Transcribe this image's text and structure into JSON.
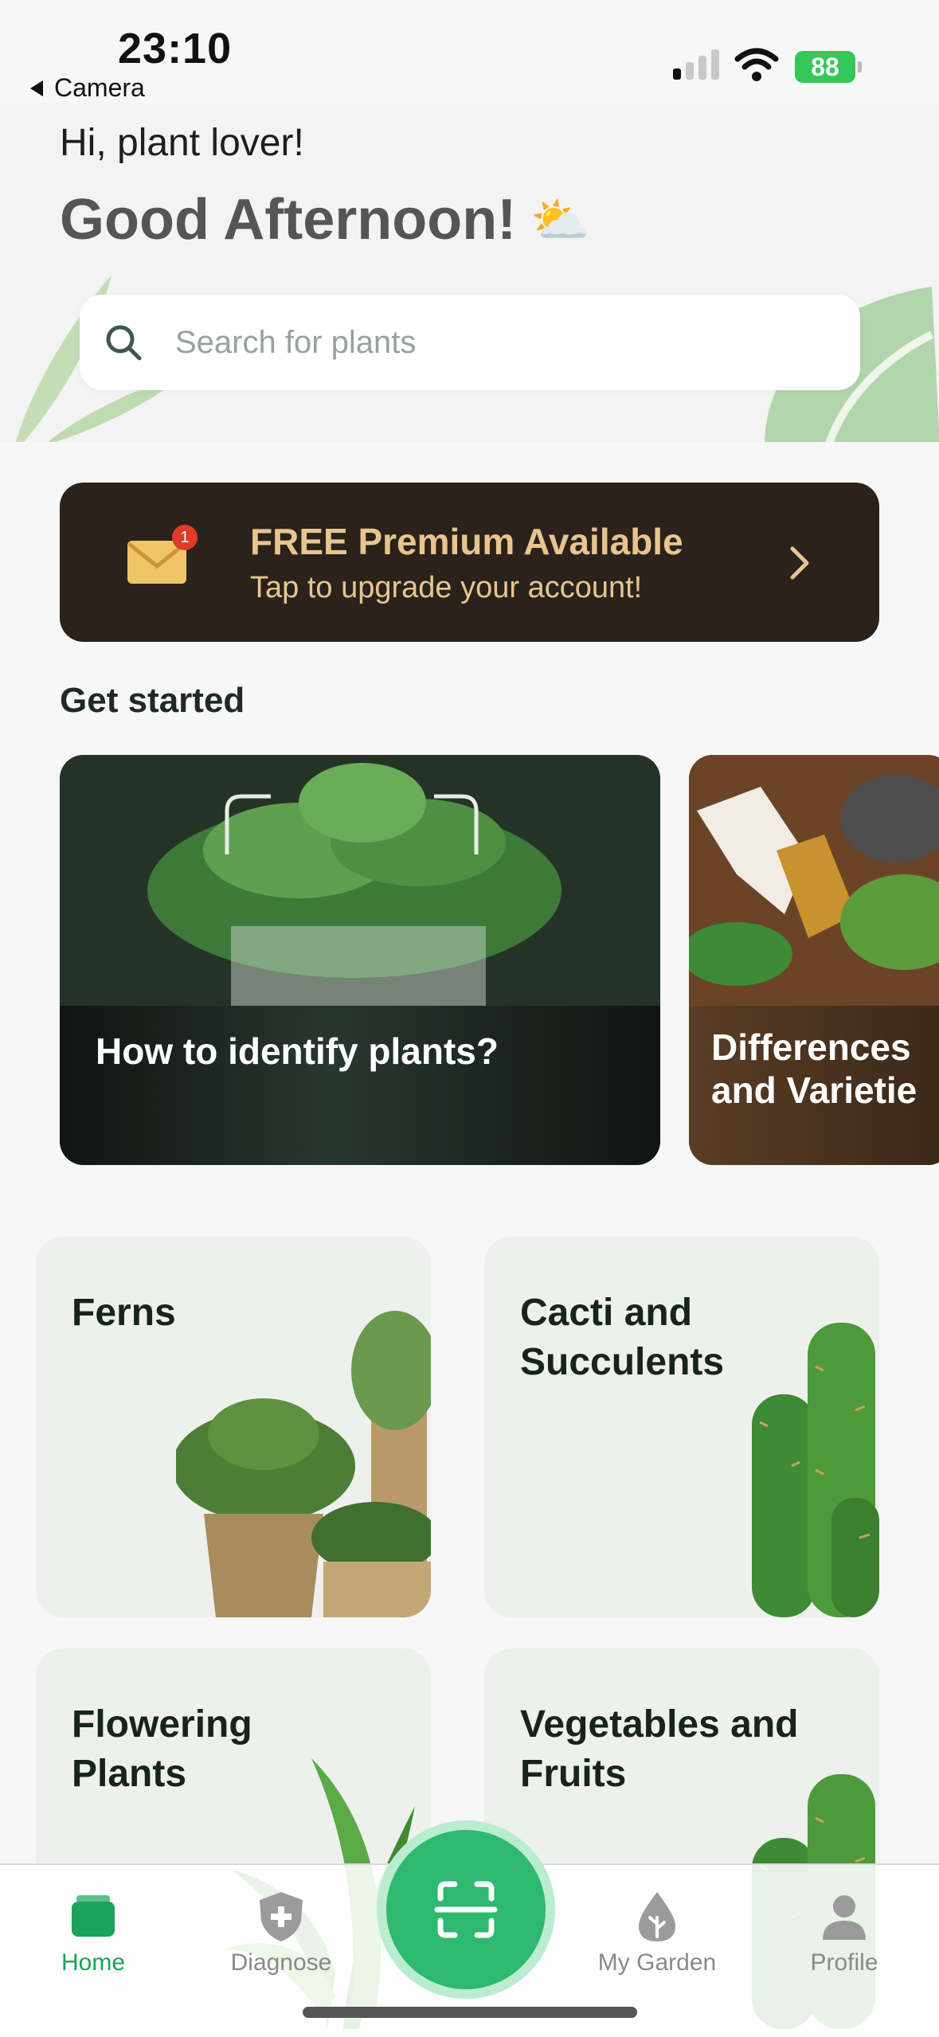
{
  "status_bar": {
    "time": "23:10",
    "back_app": "Camera",
    "battery": "88"
  },
  "header": {
    "greeting": "Hi, plant lover!",
    "headline": "Good Afternoon!",
    "headline_emoji": "⛅",
    "search_placeholder": "Search for plants"
  },
  "premium": {
    "badge_count": "1",
    "title": "FREE Premium Available",
    "subtitle": "Tap to upgrade your account!"
  },
  "get_started": {
    "title": "Get started",
    "cards": [
      {
        "label": "How to identify plants?"
      },
      {
        "label_line1": "Differences",
        "label_line2": "and Varietie"
      }
    ]
  },
  "categories": [
    {
      "line1": "Ferns",
      "line2": ""
    },
    {
      "line1": "Cacti and",
      "line2": "Succulents"
    },
    {
      "line1": "Flowering",
      "line2": "Plants"
    },
    {
      "line1": "Vegetables and",
      "line2": "Fruits"
    }
  ],
  "tabbar": {
    "home": "Home",
    "diagnose": "Diagnose",
    "my_garden": "My Garden",
    "profile": "Profile"
  },
  "colors": {
    "accent": "#2db96f",
    "banner_bg": "#2a221b",
    "banner_text": "#e8c58f"
  }
}
